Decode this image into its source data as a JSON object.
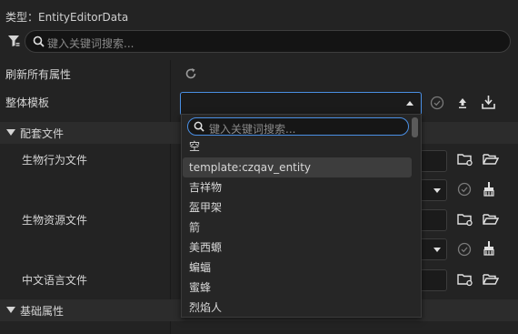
{
  "header": {
    "type_label": "类型：EntityEditorData",
    "search_placeholder": "键入关键词搜索..."
  },
  "rows": {
    "refresh_all": "刷新所有属性",
    "template_label": "整体模板"
  },
  "sections": {
    "matching_files": "配套文件",
    "basic_props": "基础属性"
  },
  "files": {
    "behavior": "生物行为文件",
    "resource": "生物资源文件",
    "language": "中文语言文件"
  },
  "dropdown": {
    "search_placeholder": "键入关键词搜索...",
    "options": [
      "空",
      "template:czqav_entity",
      "吉祥物",
      "盔甲架",
      "箭",
      "美西螈",
      "蝙蝠",
      "蜜蜂",
      "烈焰人"
    ],
    "highlighted_index": 1
  },
  "colors": {
    "accent": "#4a8fe4",
    "background": "#232323",
    "section": "#2c2c2c"
  }
}
